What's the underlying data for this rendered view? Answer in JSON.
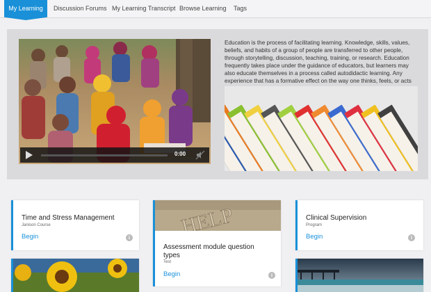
{
  "nav": {
    "tabs": [
      {
        "label": "My Learning",
        "active": true
      },
      {
        "label": "Discussion Forums"
      },
      {
        "label": "My Learning Transcript"
      },
      {
        "label": "Browse Learning"
      },
      {
        "label": "Tags"
      }
    ]
  },
  "hero": {
    "description": "Education is the process of facilitating learning. Knowledge, skills, values, beliefs, and habits of a group of people are transferred to other people, through storytelling, discussion, teaching, training, or research. Education frequently takes place under the guidance of educators, but learners may also educate themselves in a process called autodidactic learning. Any experience that has a formative effect on the way one thinks, feels, or acts may be considered educatio",
    "video": {
      "time": "0:00",
      "progress": 0
    }
  },
  "cards": [
    {
      "title": "Time and Stress Management",
      "subtitle": "Janison Course",
      "link": "Begin"
    },
    {
      "title": "Assessment module question types",
      "subtitle": "Test",
      "link": "Begin",
      "image_text": "HELP"
    },
    {
      "title": "Clinical Supervision",
      "subtitle": "Program",
      "link": "Begin"
    }
  ],
  "colors": {
    "accent": "#1990d8",
    "hero_bg": "#dadadc",
    "page_bg": "#f0f0f2"
  },
  "icons": {
    "info": "i"
  }
}
